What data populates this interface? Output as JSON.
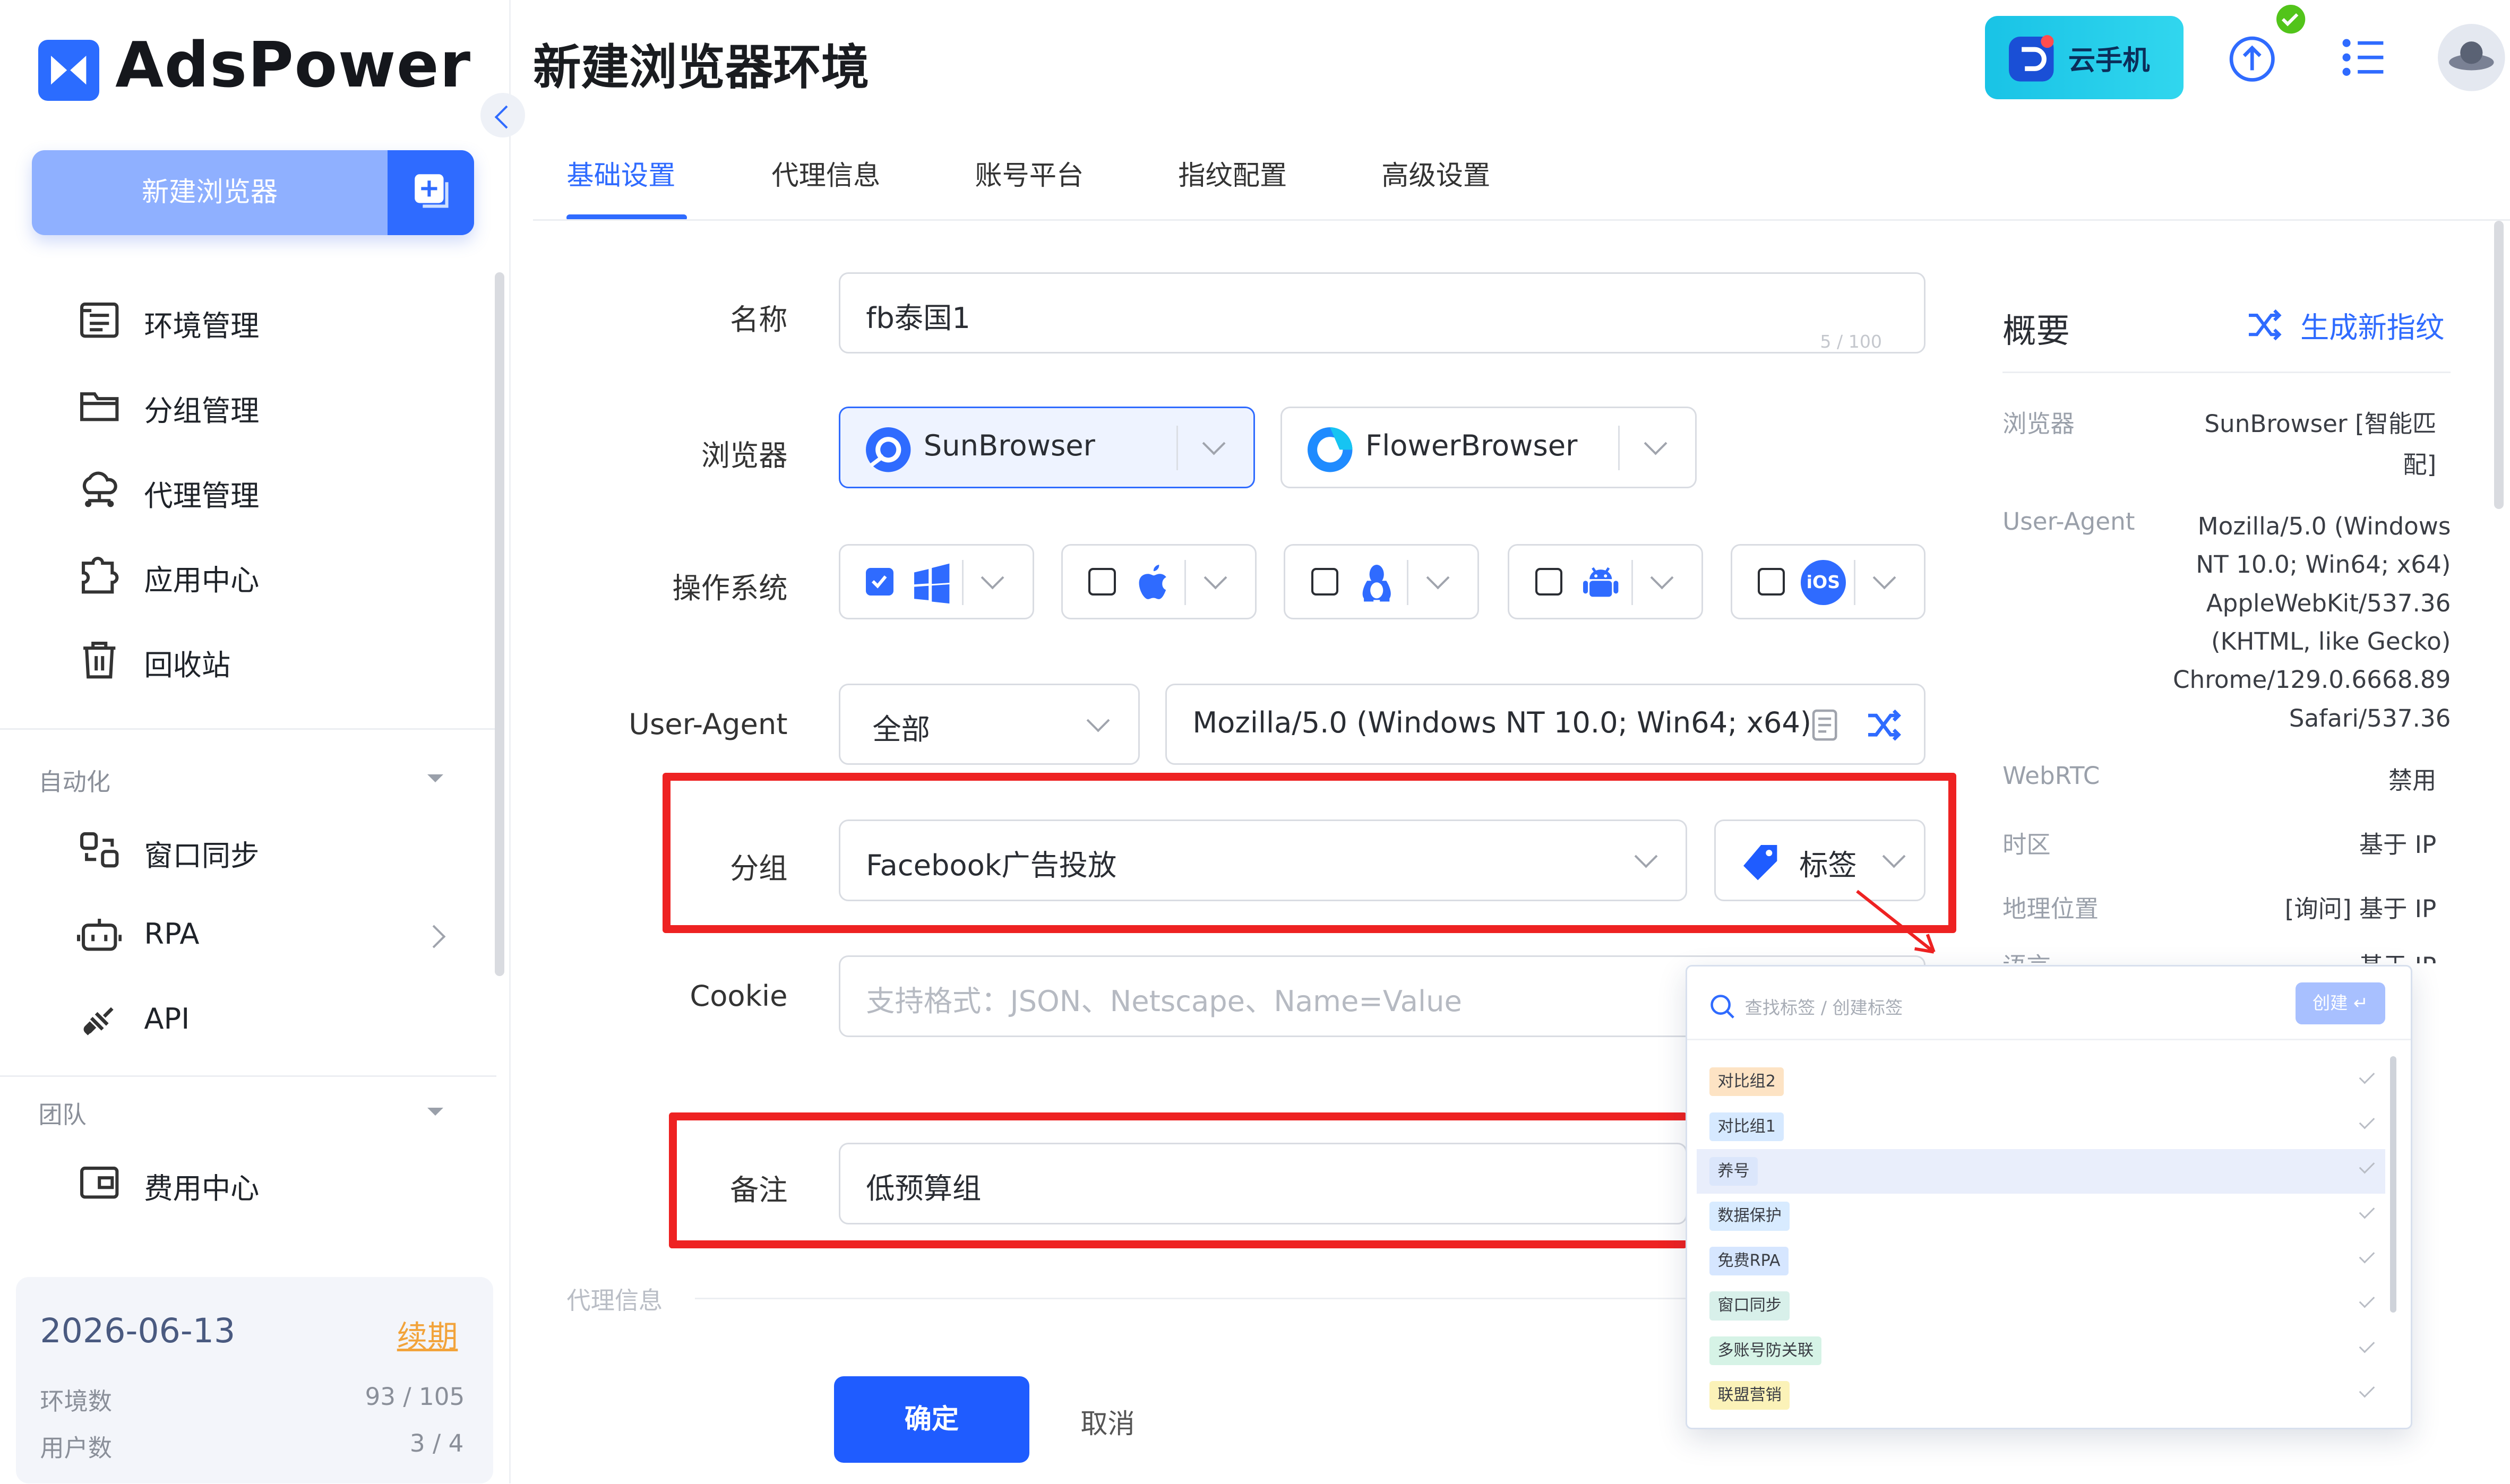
{
  "app": {
    "logo_text": "AdsPower",
    "page_title": "新建浏览器环境",
    "cloud_phone": "云手机"
  },
  "sidebar": {
    "new_browser": "新建浏览器",
    "items": [
      {
        "label": "环境管理",
        "icon": "list-icon"
      },
      {
        "label": "分组管理",
        "icon": "folder-icon"
      },
      {
        "label": "代理管理",
        "icon": "cloud-network-icon"
      },
      {
        "label": "应用中心",
        "icon": "puzzle-icon"
      },
      {
        "label": "回收站",
        "icon": "trash-icon"
      }
    ],
    "section_automation": "自动化",
    "automation_items": [
      {
        "label": "窗口同步",
        "icon": "window-sync-icon"
      },
      {
        "label": "RPA",
        "icon": "robot-icon"
      },
      {
        "label": "API",
        "icon": "plug-icon"
      }
    ],
    "section_team": "团队",
    "team_items": [
      {
        "label": "费用中心",
        "icon": "wallet-icon"
      }
    ],
    "footer": {
      "date": "2026-06-13",
      "renew": "续期",
      "env_label": "环境数",
      "env_value": "93 / 105",
      "user_label": "用户数",
      "user_value": "3 / 4"
    }
  },
  "tabs": [
    "基础设置",
    "代理信息",
    "账号平台",
    "指纹配置",
    "高级设置"
  ],
  "active_tab": "基础设置",
  "form": {
    "name_label": "名称",
    "name_value": "fb泰国1",
    "name_counter": "5 / 100",
    "browser_label": "浏览器",
    "browser_options": [
      "SunBrowser",
      "FlowerBrowser"
    ],
    "browser_selected": "SunBrowser",
    "os_label": "操作系统",
    "os_options": [
      {
        "name": "windows",
        "checked": true,
        "icon": "windows-icon"
      },
      {
        "name": "macos",
        "checked": false,
        "icon": "apple-icon"
      },
      {
        "name": "linux",
        "checked": false,
        "icon": "linux-icon"
      },
      {
        "name": "android",
        "checked": false,
        "icon": "android-icon"
      },
      {
        "name": "ios",
        "checked": false,
        "icon": "ios-icon",
        "text": "iOS"
      }
    ],
    "ua_label": "User-Agent",
    "ua_filter": "全部",
    "ua_value": "Mozilla/5.0 (Windows NT 10.0; Win64; x64)",
    "group_label": "分组",
    "group_value": "Facebook广告投放",
    "tag_button": "标签",
    "cookie_label": "Cookie",
    "cookie_placeholder": "支持格式：JSON、Netscape、Name=Value",
    "note_label": "备注",
    "note_value": "低预算组",
    "proxy_section": "代理信息"
  },
  "summary": {
    "title": "概要",
    "generate": "生成新指纹",
    "rows": [
      {
        "key": "浏览器",
        "value_lines": [
          "SunBrowser [智能匹",
          "配]"
        ]
      },
      {
        "key": "User-Agent",
        "value_lines": [
          "Mozilla/5.0 (Windows",
          "NT 10.0; Win64; x64)",
          "AppleWebKit/537.36",
          "(KHTML, like Gecko)",
          "Chrome/129.0.6668.89",
          "Safari/537.36"
        ]
      },
      {
        "key": "WebRTC",
        "value_lines": [
          "禁用"
        ]
      },
      {
        "key": "时区",
        "value_lines": [
          "基于 IP"
        ]
      },
      {
        "key": "地理位置",
        "value_lines": [
          "[询问] 基于 IP"
        ]
      },
      {
        "key": "语言",
        "value_lines": [
          "基于 IP"
        ]
      }
    ]
  },
  "tag_popup": {
    "search_placeholder": "查找标签 / 创建标签",
    "create_label": "创建 ↵",
    "tags": [
      {
        "label": "对比组2",
        "color": "#fde3c4"
      },
      {
        "label": "对比组1",
        "color": "#d6e9ff"
      },
      {
        "label": "养号",
        "color": "#dbe6fb"
      },
      {
        "label": "数据保护",
        "color": "#d8ebff"
      },
      {
        "label": "免费RPA",
        "color": "#d6e6ff"
      },
      {
        "label": "窗口同步",
        "color": "#d8f0ea"
      },
      {
        "label": "多账号防关联",
        "color": "#d6f3e6"
      },
      {
        "label": "联盟营销",
        "color": "#fbf2b8"
      }
    ]
  },
  "buttons": {
    "ok": "确定",
    "cancel": "取消"
  },
  "colors": {
    "accent": "#2f6bff",
    "highlight": "#ee2222"
  }
}
